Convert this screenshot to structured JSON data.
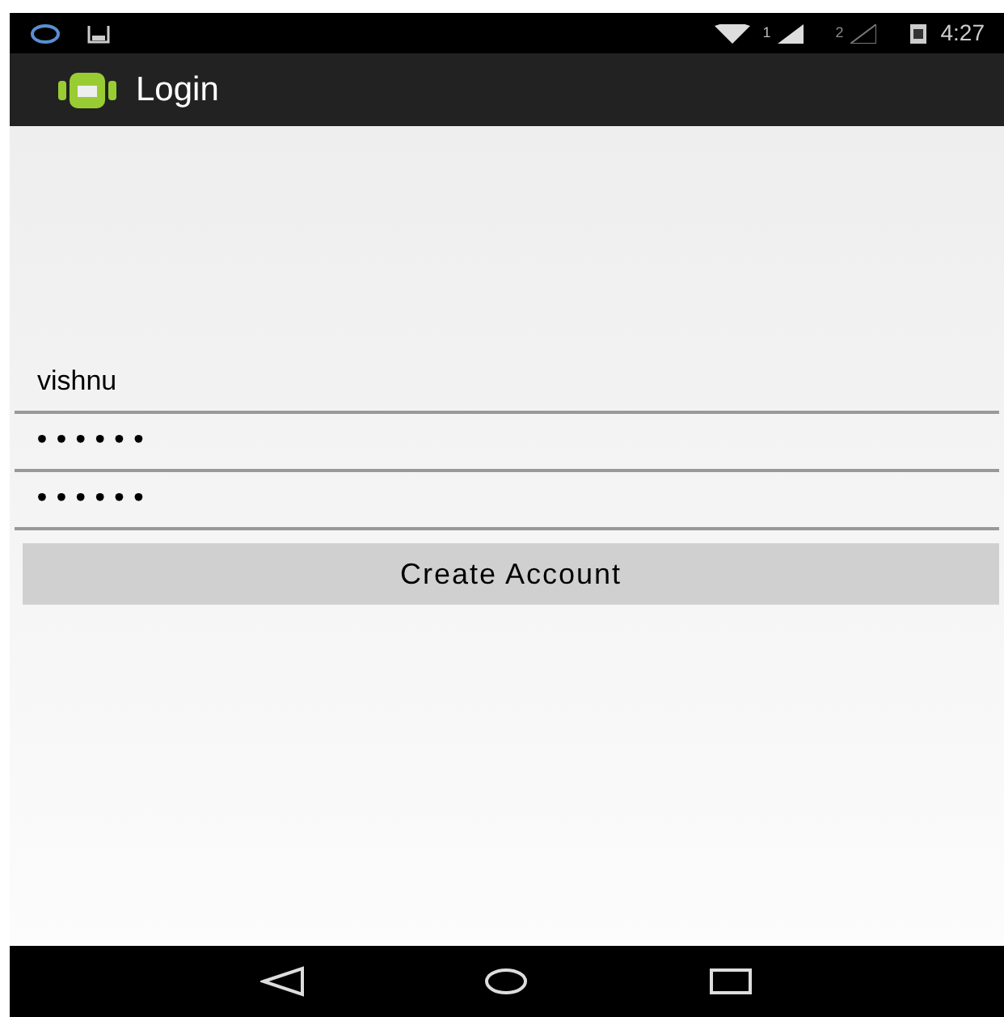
{
  "status_bar": {
    "sim1": "1",
    "sim2": "2",
    "time": "4:27"
  },
  "action_bar": {
    "title": "Login"
  },
  "fields": [
    {
      "kind": "text",
      "value": "vishnu"
    },
    {
      "kind": "password",
      "value": "••••••"
    },
    {
      "kind": "password",
      "value": "••••••"
    }
  ],
  "button": {
    "label": "Create Account"
  }
}
